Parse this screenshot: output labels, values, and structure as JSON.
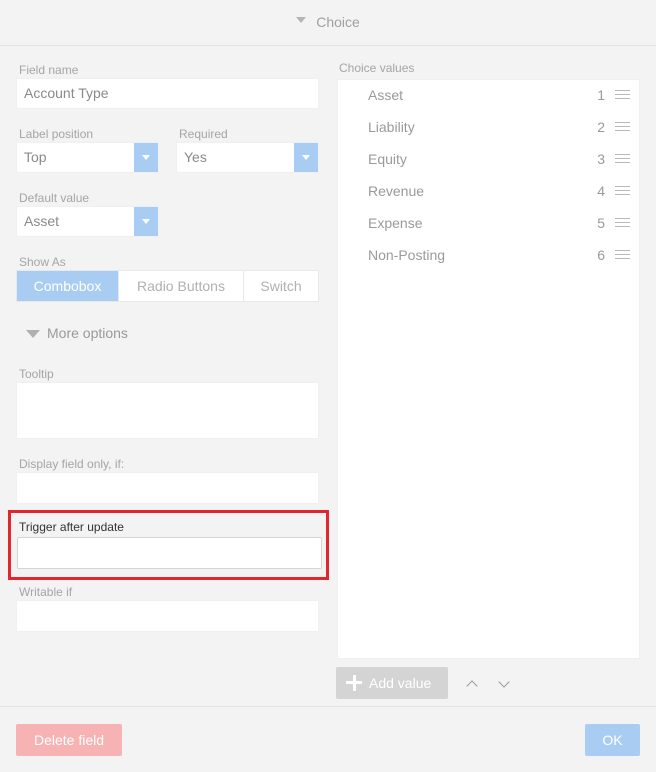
{
  "header": {
    "title": "Choice"
  },
  "left": {
    "field_name": {
      "label": "Field name",
      "value": "Account Type"
    },
    "label_position": {
      "label": "Label position",
      "value": "Top"
    },
    "required": {
      "label": "Required",
      "value": "Yes"
    },
    "default_value": {
      "label": "Default value",
      "value": "Asset"
    },
    "show_as": {
      "label": "Show As",
      "options": [
        "Combobox",
        "Radio Buttons",
        "Switch"
      ],
      "selected": "Combobox"
    },
    "more_options": "More options",
    "tooltip": {
      "label": "Tooltip",
      "value": ""
    },
    "display_if": {
      "label": "Display field only, if:",
      "value": ""
    },
    "trigger_after_update": {
      "label": "Trigger after update",
      "value": ""
    },
    "writable_if": {
      "label": "Writable if",
      "value": ""
    }
  },
  "right": {
    "label": "Choice values",
    "choices": [
      {
        "name": "Asset",
        "num": "1"
      },
      {
        "name": "Liability",
        "num": "2"
      },
      {
        "name": "Equity",
        "num": "3"
      },
      {
        "name": "Revenue",
        "num": "4"
      },
      {
        "name": "Expense",
        "num": "5"
      },
      {
        "name": "Non-Posting",
        "num": "6"
      }
    ],
    "add_value": "Add value"
  },
  "footer": {
    "delete_label": "Delete field",
    "ok_label": "OK"
  },
  "colors": {
    "accent": "#a9cdf2",
    "danger": "#f7b3b3",
    "highlight": "#e3262b"
  }
}
